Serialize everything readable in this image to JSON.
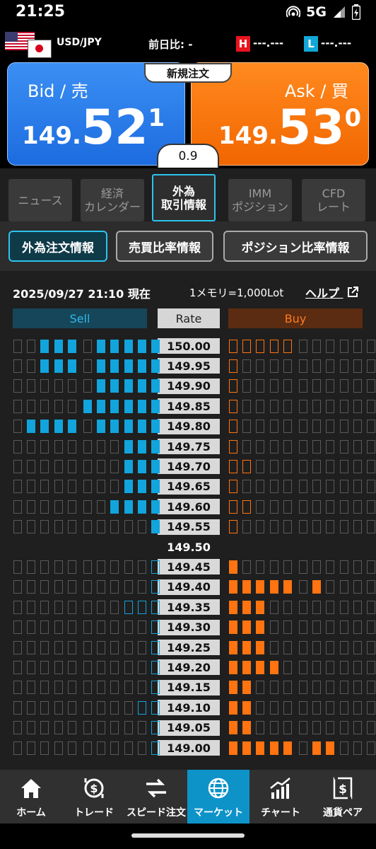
{
  "status_bar": {
    "time": "21:25",
    "network": "5G"
  },
  "header": {
    "pair": "USD/JPY",
    "change_label": "前日比: -",
    "high_label": "H",
    "high_value": "---.---",
    "low_label": "L",
    "low_value": "---.---"
  },
  "quote": {
    "bid_label": "Bid / 売",
    "bid_small": "149.",
    "bid_big": "52",
    "bid_sup": "1",
    "ask_label": "Ask / 買",
    "ask_small": "149.",
    "ask_big": "53",
    "ask_sup": "0",
    "new_order": "新規注文",
    "spread": "0.9",
    "colors": {
      "bid": "#1d6ce0",
      "ask": "#f26600"
    }
  },
  "tabs": [
    {
      "l1": "ニュース",
      "l2": "",
      "active": false
    },
    {
      "l1": "経済",
      "l2": "カレンダー",
      "active": false
    },
    {
      "l1": "外為",
      "l2": "取引情報",
      "active": true
    },
    {
      "l1": "IMM",
      "l2": "ポジション",
      "active": false
    },
    {
      "l1": "CFD",
      "l2": "レート",
      "active": false
    }
  ],
  "subtabs": [
    {
      "label": "外為注文情報",
      "active": true
    },
    {
      "label": "売買比率情報",
      "active": false
    },
    {
      "label": "ポジション比率情報",
      "active": false
    }
  ],
  "info": {
    "datetime": "2025/09/27 21:10 現在",
    "memo": "1メモリ=1,000Lot",
    "help": "ヘルプ"
  },
  "book": {
    "sell_head": "Sell",
    "rate_head": "Rate",
    "buy_head": "Buy",
    "rows": [
      {
        "rate": "150.00",
        "sell": "--fff-fffff",
        "buy": "ooooo------"
      },
      {
        "rate": "149.95",
        "sell": "--fff-fffff",
        "buy": "o----------"
      },
      {
        "rate": "149.90",
        "sell": "------fffff",
        "buy": "o----------"
      },
      {
        "rate": "149.85",
        "sell": "-----ffffff",
        "buy": "o----------"
      },
      {
        "rate": "149.80",
        "sell": "-ffff-fffff",
        "buy": "o----------"
      },
      {
        "rate": "149.75",
        "sell": "--------fff",
        "buy": "o----------"
      },
      {
        "rate": "149.70",
        "sell": "--------fff",
        "buy": "oo---------"
      },
      {
        "rate": "149.65",
        "sell": "--------fff",
        "buy": "o----------"
      },
      {
        "rate": "149.60",
        "sell": "-------ffff",
        "buy": "oo---------"
      },
      {
        "rate": "149.55",
        "sell": "----------f",
        "buy": "o----------"
      },
      {
        "rate": "149.50",
        "sell": "",
        "buy": "",
        "mid": true
      },
      {
        "rate": "149.45",
        "sell": "----------o",
        "buy": "f----------"
      },
      {
        "rate": "149.40",
        "sell": "----------o",
        "buy": "fffff-f----"
      },
      {
        "rate": "149.35",
        "sell": "--------ooo",
        "buy": "fff--------"
      },
      {
        "rate": "149.30",
        "sell": "----------o",
        "buy": "fff--------"
      },
      {
        "rate": "149.25",
        "sell": "----------o",
        "buy": "fff--------"
      },
      {
        "rate": "149.20",
        "sell": "----------o",
        "buy": "ffff-------"
      },
      {
        "rate": "149.15",
        "sell": "----------o",
        "buy": "ff---------"
      },
      {
        "rate": "149.10",
        "sell": "---------oo",
        "buy": "ff---------"
      },
      {
        "rate": "149.05",
        "sell": "----------o",
        "buy": "ff---------"
      },
      {
        "rate": "149.00",
        "sell": "----------o",
        "buy": "fffff-ff---"
      }
    ]
  },
  "bottom_nav": [
    {
      "label": "ホーム",
      "icon": "home-icon",
      "active": false
    },
    {
      "label": "トレード",
      "icon": "trade-icon",
      "active": false
    },
    {
      "label": "スピード注文",
      "icon": "speed-order-icon",
      "active": false
    },
    {
      "label": "マーケット",
      "icon": "globe-icon",
      "active": true
    },
    {
      "label": "チャート",
      "icon": "chart-icon",
      "active": false
    },
    {
      "label": "通貨ペア",
      "icon": "currency-pair-icon",
      "active": false
    }
  ]
}
